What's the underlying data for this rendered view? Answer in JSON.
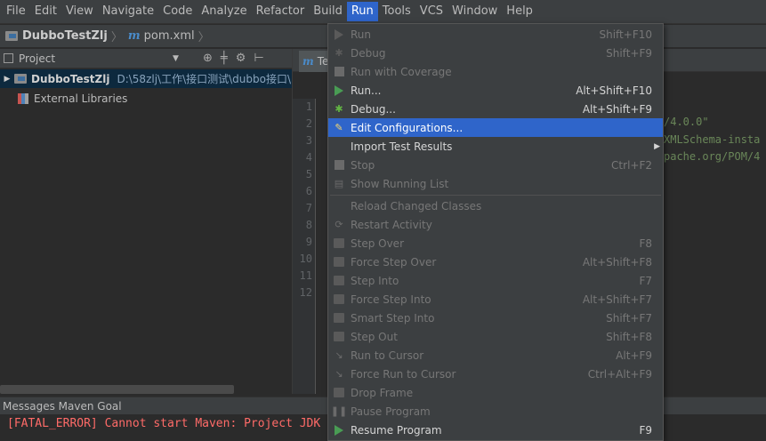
{
  "menubar": {
    "items": [
      "File",
      "Edit",
      "View",
      "Navigate",
      "Code",
      "Analyze",
      "Refactor",
      "Build",
      "Run",
      "Tools",
      "VCS",
      "Window",
      "Help"
    ],
    "active": "Run"
  },
  "navbar": {
    "project": "DubboTestZlj",
    "file": "pom.xml"
  },
  "project_panel": {
    "title": "Project",
    "tree": [
      {
        "name": "DubboTestZlj",
        "path": "D:\\58zlj\\工作\\接口测试\\dubbo接口\\"
      },
      {
        "name": "External Libraries"
      }
    ]
  },
  "editor": {
    "tab_label": "Te",
    "line_numbers": [
      "1",
      "2",
      "3",
      "4",
      "5",
      "6",
      "7",
      "8",
      "9",
      "10",
      "11",
      "12"
    ],
    "fragments": [
      "/4.0.0\"",
      "XMLSchema-insta",
      "pache.org/POM/4"
    ]
  },
  "run_menu": {
    "items": [
      {
        "label": "Run",
        "shortcut": "Shift+F10",
        "enabled": false,
        "icon": "run-icon"
      },
      {
        "label": "Debug",
        "shortcut": "Shift+F9",
        "enabled": false,
        "icon": "debug-icon"
      },
      {
        "label": "Run with Coverage",
        "shortcut": "",
        "enabled": false,
        "icon": "coverage-icon"
      },
      {
        "label": "Run...",
        "shortcut": "Alt+Shift+F10",
        "enabled": true,
        "icon": "run-icon"
      },
      {
        "label": "Debug...",
        "shortcut": "Alt+Shift+F9",
        "enabled": true,
        "icon": "debug-icon"
      },
      {
        "label": "Edit Configurations...",
        "shortcut": "",
        "enabled": true,
        "highlighted": true,
        "icon": "edit-config-icon"
      },
      {
        "label": "Import Test Results",
        "shortcut": "",
        "enabled": true,
        "submenu": true,
        "icon": ""
      },
      {
        "label": "Stop",
        "shortcut": "Ctrl+F2",
        "enabled": false,
        "icon": "stop-icon"
      },
      {
        "label": "Show Running List",
        "shortcut": "",
        "enabled": false,
        "icon": "list-icon"
      },
      {
        "label": "Reload Changed Classes",
        "shortcut": "",
        "enabled": false,
        "icon": ""
      },
      {
        "label": "Restart Activity",
        "shortcut": "",
        "enabled": false,
        "icon": "restart-icon"
      },
      {
        "label": "Step Over",
        "shortcut": "F8",
        "enabled": false,
        "icon": "step-over-icon"
      },
      {
        "label": "Force Step Over",
        "shortcut": "Alt+Shift+F8",
        "enabled": false,
        "icon": "force-step-over-icon"
      },
      {
        "label": "Step Into",
        "shortcut": "F7",
        "enabled": false,
        "icon": "step-into-icon"
      },
      {
        "label": "Force Step Into",
        "shortcut": "Alt+Shift+F7",
        "enabled": false,
        "icon": "force-step-into-icon"
      },
      {
        "label": "Smart Step Into",
        "shortcut": "Shift+F7",
        "enabled": false,
        "icon": "smart-step-into-icon"
      },
      {
        "label": "Step Out",
        "shortcut": "Shift+F8",
        "enabled": false,
        "icon": "step-out-icon"
      },
      {
        "label": "Run to Cursor",
        "shortcut": "Alt+F9",
        "enabled": false,
        "icon": "run-to-cursor-icon"
      },
      {
        "label": "Force Run to Cursor",
        "shortcut": "Ctrl+Alt+F9",
        "enabled": false,
        "icon": "force-run-to-cursor-icon"
      },
      {
        "label": "Drop Frame",
        "shortcut": "",
        "enabled": false,
        "icon": "drop-frame-icon"
      },
      {
        "label": "Pause Program",
        "shortcut": "",
        "enabled": false,
        "icon": "pause-icon"
      },
      {
        "label": "Resume Program",
        "shortcut": "F9",
        "enabled": true,
        "icon": "resume-icon"
      }
    ]
  },
  "bottom_panel": {
    "title": "Messages Maven Goal",
    "error": "[FATAL_ERROR] Cannot start Maven: Project JDK"
  },
  "colors": {
    "highlight": "#2f65ca",
    "error": "#ff6b68",
    "run_green": "#499c54"
  }
}
